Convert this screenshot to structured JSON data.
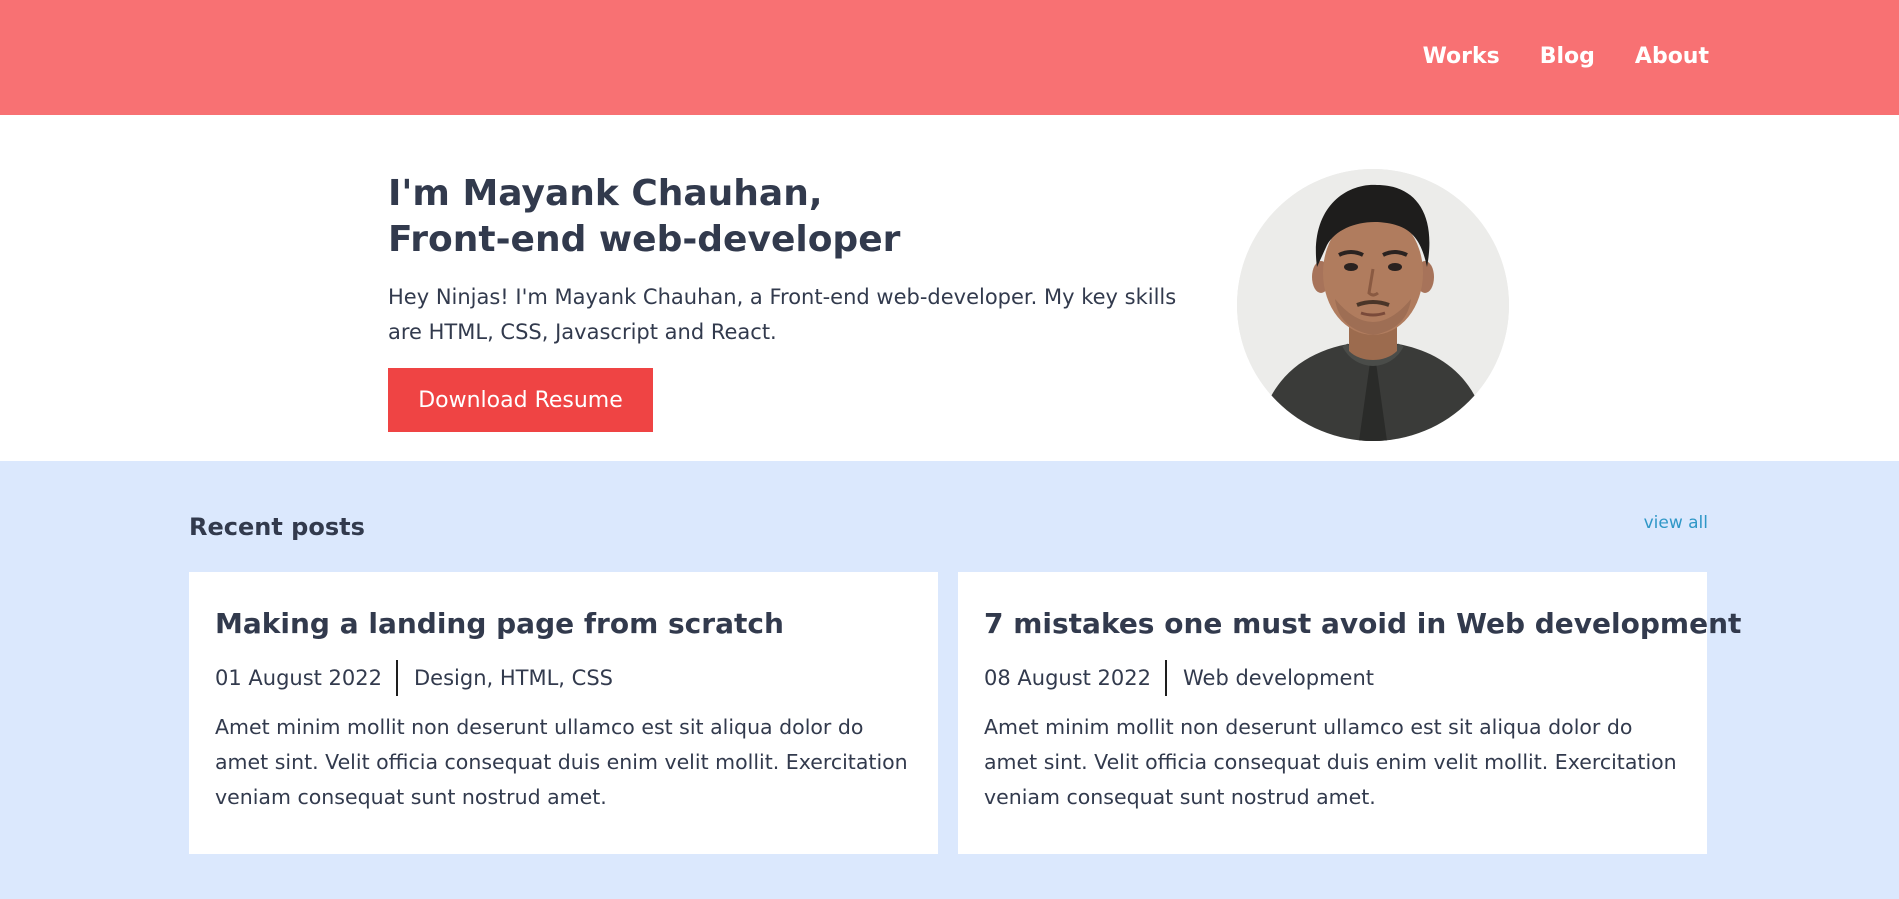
{
  "nav": {
    "items": [
      {
        "label": "Works"
      },
      {
        "label": "Blog"
      },
      {
        "label": "About"
      }
    ]
  },
  "hero": {
    "title_line1": "I'm Mayank Chauhan,",
    "title_line2": "Front-end web-developer",
    "description": "Hey Ninjas! I'm Mayank Chauhan, a Front-end web-developer. My key skills are HTML, CSS, Javascript and React.",
    "button_label": "Download Resume",
    "avatar_alt": "profile photo"
  },
  "recent_posts": {
    "heading": "Recent posts",
    "view_all_label": "view all",
    "posts": [
      {
        "title": "Making a landing page from scratch",
        "date": "01 August 2022",
        "tags": "Design, HTML, CSS",
        "excerpt": "Amet minim mollit non deserunt ullamco est sit aliqua dolor do amet sint. Velit officia consequat duis enim velit mollit. Exercitation veniam consequat sunt nostrud amet."
      },
      {
        "title": "7 mistakes one must avoid in Web development",
        "date": "08 August 2022",
        "tags": "Web development",
        "excerpt": "Amet minim mollit non deserunt ullamco est sit aliqua dolor do amet sint. Velit officia consequat duis enim velit mollit. Exercitation veniam consequat sunt nostrud amet."
      }
    ]
  },
  "colors": {
    "header_bg": "#f87173",
    "button_bg": "#ef4444",
    "posts_bg": "#dbe8fd",
    "link": "#2f97c7",
    "text": "#323a4d"
  }
}
